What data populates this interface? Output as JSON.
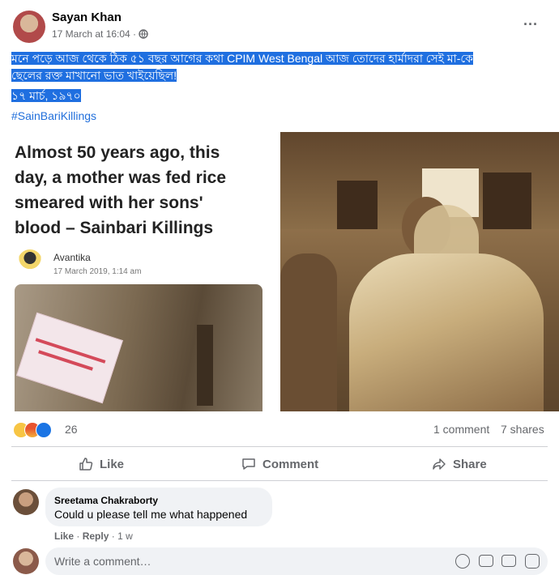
{
  "post": {
    "author": "Sayan Khan",
    "timestamp": "17 March at 16:04 · ",
    "text_line1": "মনে পড়ে আজ থেকে ঠিক ৫১ বছর আগের কথা CPIM West Bengal আজ তোদের হার্মাদরা সেই মা-কে",
    "text_line2": "ছেলের রক্ত মাখানো ভাত খাইয়েছিল!",
    "text_date": "১৭ মার্চ, ১৯৭০",
    "hashtag": "#SainBariKillings",
    "more": "···"
  },
  "shared_card": {
    "headline_line1": "Almost 50 years ago, this",
    "headline_line2": "day, a mother was fed rice",
    "headline_line3": "smeared with her sons'",
    "headline_line4": "blood – Sainbari Killings",
    "author": "Avantika",
    "date": "17 March 2019, 1:14 am"
  },
  "stats": {
    "reaction_count": "26",
    "comments": "1 comment",
    "shares": "7 shares"
  },
  "actions": {
    "like": "Like",
    "comment": "Comment",
    "share": "Share"
  },
  "comment": {
    "author": "Sreetama Chakraborty",
    "text": "Could u please tell me what happened",
    "like": "Like",
    "reply": "Reply",
    "time": "1 w"
  },
  "composer": {
    "placeholder": "Write a comment…"
  },
  "colors": {
    "highlight": "#1f6fe0",
    "hashtag": "#216fdb",
    "sepia": "#8a6a45"
  }
}
